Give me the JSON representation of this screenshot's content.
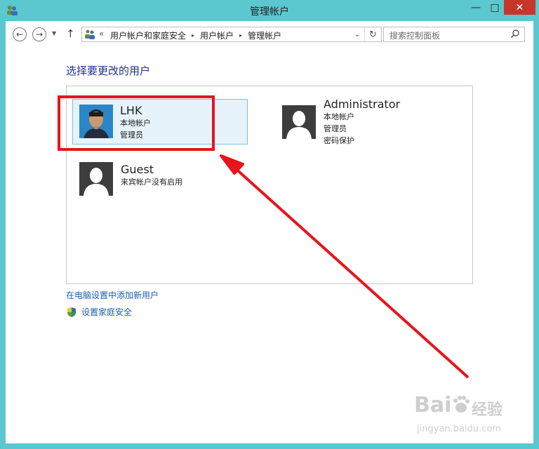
{
  "window": {
    "title": "管理帐户",
    "min_label": "—",
    "max_label": "□",
    "close_label": "✕"
  },
  "nav": {
    "back_glyph": "←",
    "forward_glyph": "→",
    "dropdown_glyph": "▼",
    "up_glyph": "↑"
  },
  "address": {
    "chevron": "«",
    "crumbs": [
      "用户帐户和家庭安全",
      "用户帐户",
      "管理帐户"
    ],
    "sep": "▸",
    "dropdown_glyph": "⌄",
    "refresh_glyph": "↻"
  },
  "search": {
    "placeholder": "搜索控制面板",
    "icon_glyph": "⚲"
  },
  "main": {
    "heading": "选择要更改的用户",
    "users": [
      {
        "name": "LHK",
        "details": [
          "本地帐户",
          "管理员"
        ],
        "selected": true
      },
      {
        "name": "Administrator",
        "details": [
          "本地帐户",
          "管理员",
          "密码保护"
        ],
        "selected": false
      },
      {
        "name": "Guest",
        "details": [
          "来宾帐户没有启用"
        ],
        "selected": false
      }
    ],
    "link_add_user": "在电脑设置中添加新用户",
    "link_family_safety": "设置家庭安全"
  },
  "watermark": {
    "logo": "Bai",
    "jingyan": "经验",
    "url": "jingyan.baidu.com"
  },
  "colors": {
    "frame": "#5bc7cf",
    "close": "#c7362b",
    "heading": "#1e3287",
    "link": "#1a5fb4",
    "selected_bg": "#e6f3fa",
    "annotation": "#e8141b"
  }
}
